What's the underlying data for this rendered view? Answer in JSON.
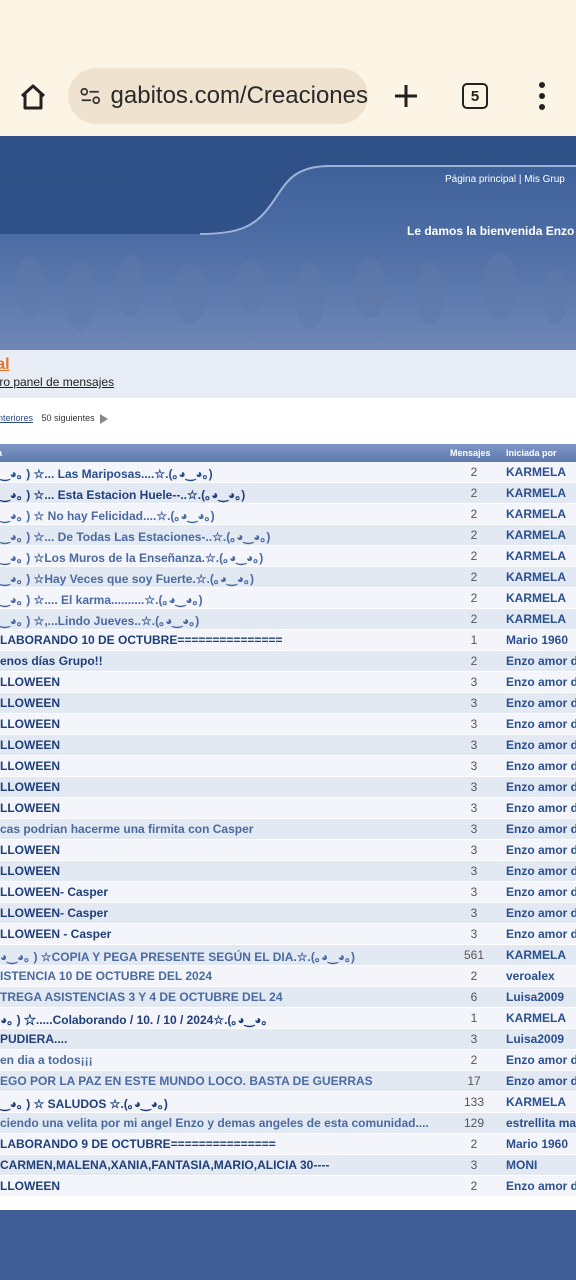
{
  "browser": {
    "url": "gabitos.com/Creaciones",
    "tab_count": "5"
  },
  "header": {
    "nav": "Página principal  |  Mis Grup",
    "welcome": "Le damos la bienvenida Enzo"
  },
  "forum": {
    "title": "ral",
    "link": "tro panel de mensajes",
    "pager_prev": "nteriores",
    "pager_next": "50 siguientes"
  },
  "table": {
    "headers": {
      "title": "a",
      "messages": "Mensajes",
      "author": "Iniciada por"
    },
    "rows": [
      {
        "title": "‿◕｡ ) ☆... Las Mariposas....☆.(｡◕‿◕｡)",
        "count": "2",
        "author": "KARMELA",
        "color": "#2a4f8e"
      },
      {
        "title": "‿◕｡ ) ☆... Esta Estacion Huele--..☆.(｡◕‿◕｡)",
        "count": "2",
        "author": "KARMELA",
        "color": "#1f3f7a"
      },
      {
        "title": "‿◕｡ ) ☆ No hay Felicidad....☆.(｡◕‿◕｡)",
        "count": "2",
        "author": "KARMELA",
        "color": "#4a6aa0"
      },
      {
        "title": "‿◕｡ ) ☆... De Todas Las Estaciones-..☆.(｡◕‿◕｡)",
        "count": "2",
        "author": "KARMELA",
        "color": "#4a6aa0"
      },
      {
        "title": "‿◕｡ ) ☆Los Muros de la Enseñanza.☆.(｡◕‿◕｡)",
        "count": "2",
        "author": "KARMELA",
        "color": "#4a6aa0"
      },
      {
        "title": "‿◕｡ ) ☆Hay Veces que soy Fuerte.☆.(｡◕‿◕｡)",
        "count": "2",
        "author": "KARMELA",
        "color": "#4a6aa0"
      },
      {
        "title": "‿◕｡ ) ☆.... El karma..........☆.(｡◕‿◕｡)",
        "count": "2",
        "author": "KARMELA",
        "color": "#4a6aa0"
      },
      {
        "title": "‿◕｡ ) ☆,...Lindo Jueves..☆.(｡◕‿◕｡)",
        "count": "2",
        "author": "KARMELA",
        "color": "#4a6aa0"
      },
      {
        "title": "LABORANDO 10 DE OCTUBRE===============",
        "count": "1",
        "author": "Mario 1960",
        "color": "#1f3f7a"
      },
      {
        "title": "enos días Grupo!!",
        "count": "2",
        "author": "Enzo amor d",
        "color": "#1f3f7a"
      },
      {
        "title": "LLOWEEN",
        "count": "3",
        "author": "Enzo amor d",
        "color": "#1f3f7a"
      },
      {
        "title": "LLOWEEN",
        "count": "3",
        "author": "Enzo amor d",
        "color": "#1f3f7a"
      },
      {
        "title": "LLOWEEN",
        "count": "3",
        "author": "Enzo amor d",
        "color": "#1f3f7a"
      },
      {
        "title": "LLOWEEN",
        "count": "3",
        "author": "Enzo amor d",
        "color": "#1f3f7a"
      },
      {
        "title": "LLOWEEN",
        "count": "3",
        "author": "Enzo amor d",
        "color": "#1f3f7a"
      },
      {
        "title": "LLOWEEN",
        "count": "3",
        "author": "Enzo amor d",
        "color": "#1f3f7a"
      },
      {
        "title": "LLOWEEN",
        "count": "3",
        "author": "Enzo amor d",
        "color": "#1f3f7a"
      },
      {
        "title": "cas podrian hacerme una firmita con Casper",
        "count": "3",
        "author": "Enzo amor d",
        "color": "#4a6aa0"
      },
      {
        "title": "LLOWEEN",
        "count": "3",
        "author": "Enzo amor d",
        "color": "#1f3f7a"
      },
      {
        "title": "LLOWEEN",
        "count": "3",
        "author": "Enzo amor d",
        "color": "#1f3f7a"
      },
      {
        "title": "LLOWEEN- Casper",
        "count": "3",
        "author": "Enzo amor d",
        "color": "#1f3f7a"
      },
      {
        "title": "LLOWEEN- Casper",
        "count": "3",
        "author": "Enzo amor d",
        "color": "#1f3f7a"
      },
      {
        "title": "LLOWEEN - Casper",
        "count": "3",
        "author": "Enzo amor d",
        "color": "#1f3f7a"
      },
      {
        "title": "◕‿◕｡ ) ☆COPIA Y PEGA PRESENTE SEGÚN EL DIA.☆.(｡◕‿◕｡)",
        "count": "561",
        "author": "KARMELA",
        "color": "#4a6aa0"
      },
      {
        "title": "ISTENCIA 10 DE OCTUBRE DEL 2024",
        "count": "2",
        "author": "veroalex",
        "color": "#4a6aa0"
      },
      {
        "title": "TREGA ASISTENCIAS 3 Y 4 DE OCTUBRE DEL 24",
        "count": "6",
        "author": "Luisa2009",
        "color": "#4a6aa0"
      },
      {
        "title": "◕｡ ) ☆.....Colaborando / 10. / 10 / 2024☆.(｡◕‿◕｡",
        "count": "1",
        "author": "KARMELA",
        "color": "#1f3f7a"
      },
      {
        "title": "PUDIERA....",
        "count": "3",
        "author": "Luisa2009",
        "color": "#1f3f7a"
      },
      {
        "title": "en dia a todos¡¡¡",
        "count": "2",
        "author": "Enzo amor d",
        "color": "#4a6aa0"
      },
      {
        "title": "EGO POR LA PAZ EN ESTE MUNDO LOCO. BASTA DE GUERRAS",
        "count": "17",
        "author": "Enzo amor d",
        "color": "#4a6aa0"
      },
      {
        "title": "‿◕｡ ) ☆ SALUDOS ☆.(｡◕‿◕｡)",
        "count": "133",
        "author": "KARMELA",
        "color": "#1f3f7a"
      },
      {
        "title": "ciendo una velita por mi angel Enzo y demas angeles de esta comunidad....",
        "count": "129",
        "author": "estrellita ma",
        "color": "#4a6aa0"
      },
      {
        "title": "LABORANDO 9 DE OCTUBRE===============",
        "count": "2",
        "author": "Mario 1960",
        "color": "#1f3f7a"
      },
      {
        "title": "CARMEN,MALENA,XANIA,FANTASIA,MARIO,ALICIA 30----",
        "count": "3",
        "author": "MONI",
        "color": "#1f3f7a"
      },
      {
        "title": "LLOWEEN",
        "count": "2",
        "author": "Enzo amor d",
        "color": "#1f3f7a"
      }
    ]
  }
}
